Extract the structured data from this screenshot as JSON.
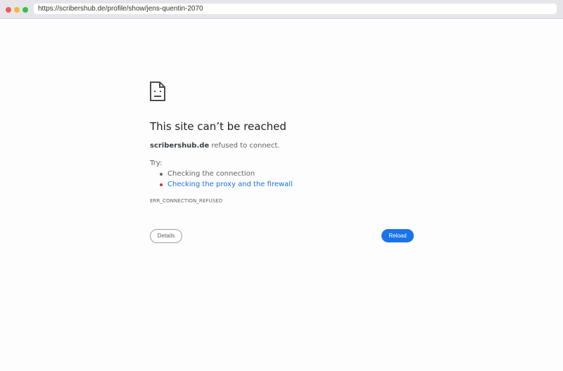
{
  "browser": {
    "url": "https://scribershub.de/profile/show/jens-quentin-2070"
  },
  "error": {
    "icon": "sad-page-icon",
    "title": "This site can’t be reached",
    "host": "scribershub.de",
    "message_suffix": " refused to connect.",
    "try_label": "Try:",
    "suggestions": [
      "Checking the connection",
      "Checking the proxy and the firewall"
    ],
    "code": "ERR_CONNECTION_REFUSED"
  },
  "buttons": {
    "details_label": "Details",
    "reload_label": "Reload"
  },
  "colors": {
    "accent": "#1a73e8",
    "text_primary": "#202124",
    "text_secondary": "#5f6368"
  }
}
